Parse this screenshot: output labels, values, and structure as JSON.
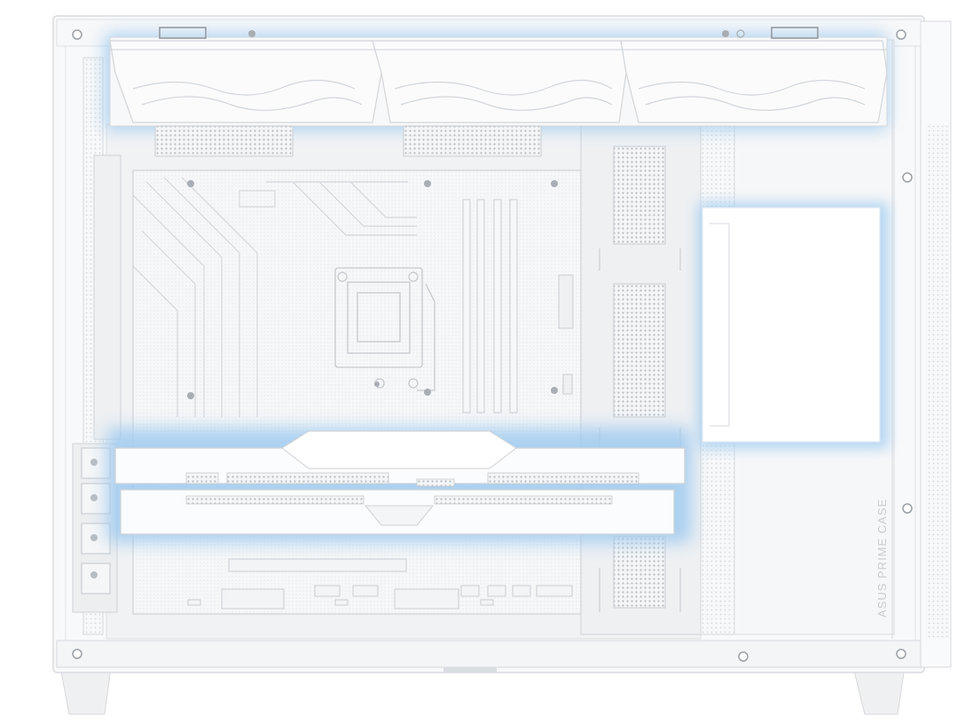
{
  "product": {
    "brand_text": "ASUS PRIME CASE"
  },
  "colors": {
    "background": "#ffffff",
    "chassis": "#f7f8f9",
    "frame_edge": "#d9dde1",
    "interior": "#f1f2f3",
    "line": "#c9cdd1",
    "mesh": "#b9bdc2",
    "glow": "#7fb8e6",
    "brand_text": "#c8ccd0"
  },
  "icons": [
    "screw-icon",
    "fan-icon",
    "mesh-vent-icon",
    "cpu-socket-icon"
  ]
}
